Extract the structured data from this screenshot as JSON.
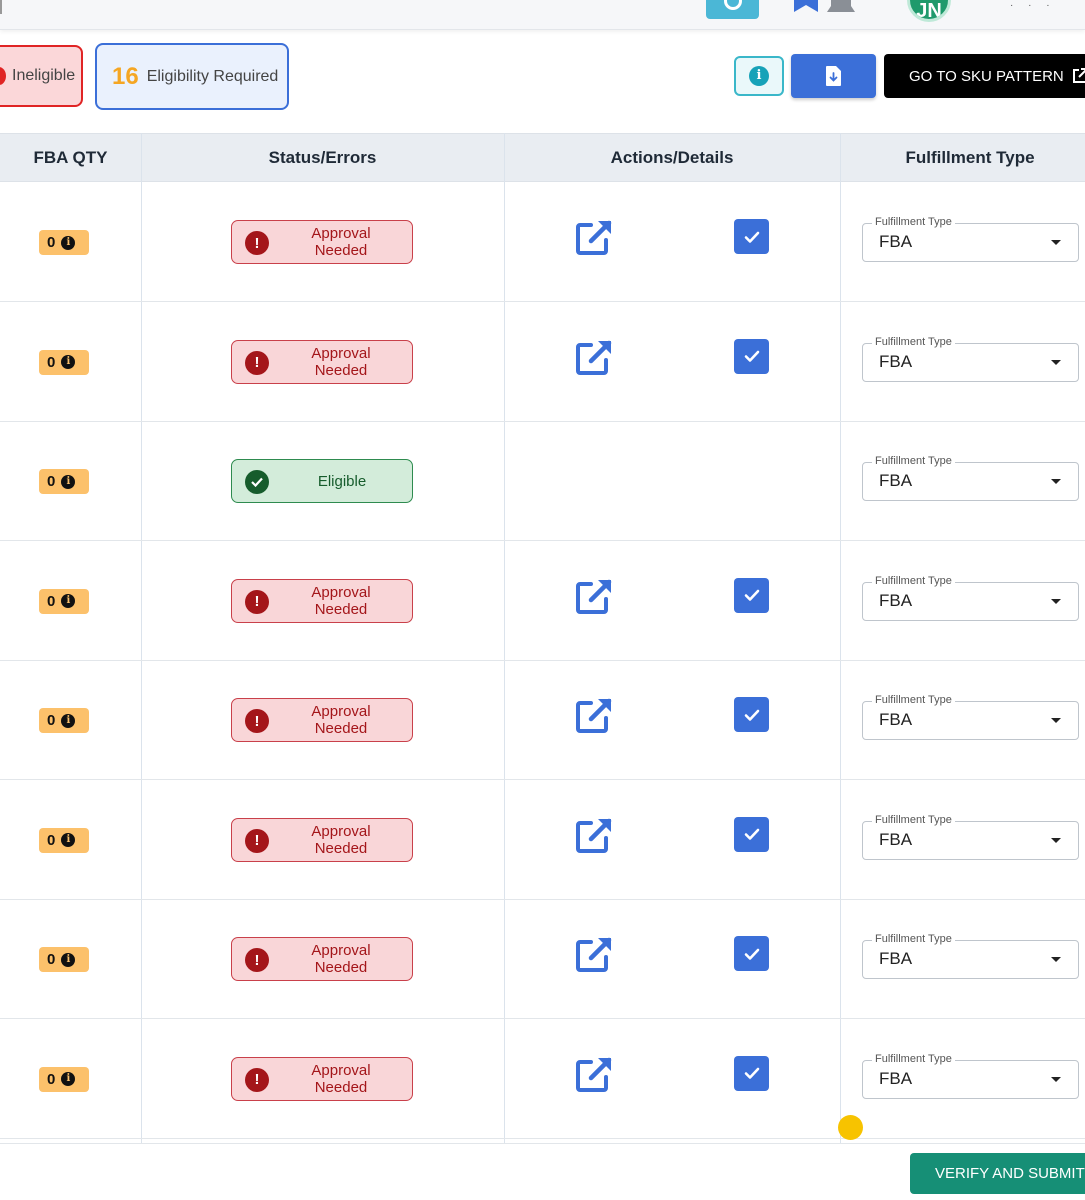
{
  "filters": {
    "ineligible": {
      "label": "Ineligible"
    },
    "eligibility_required": {
      "count": "16",
      "label": "Eligibility Required"
    }
  },
  "toolbar": {
    "info_glyph": "i",
    "sku_pattern_label": "GO TO SKU PATTERN"
  },
  "table": {
    "headers": {
      "qty": "FBA QTY",
      "status": "Status/Errors",
      "actions": "Actions/Details",
      "fulfillment": "Fulfillment Type"
    },
    "rows": [
      {
        "qty": "0",
        "status": "Approval Needed",
        "status_kind": "bad",
        "has_actions": true,
        "fulfillment_legend": "Fulfillment Type",
        "fulfillment_value": "FBA"
      },
      {
        "qty": "0",
        "status": "Approval Needed",
        "status_kind": "bad",
        "has_actions": true,
        "fulfillment_legend": "Fulfillment Type",
        "fulfillment_value": "FBA"
      },
      {
        "qty": "0",
        "status": "Eligible",
        "status_kind": "good",
        "has_actions": false,
        "fulfillment_legend": "Fulfillment Type",
        "fulfillment_value": "FBA"
      },
      {
        "qty": "0",
        "status": "Approval Needed",
        "status_kind": "bad",
        "has_actions": true,
        "fulfillment_legend": "Fulfillment Type",
        "fulfillment_value": "FBA"
      },
      {
        "qty": "0",
        "status": "Approval Needed",
        "status_kind": "bad",
        "has_actions": true,
        "fulfillment_legend": "Fulfillment Type",
        "fulfillment_value": "FBA"
      },
      {
        "qty": "0",
        "status": "Approval Needed",
        "status_kind": "bad",
        "has_actions": true,
        "fulfillment_legend": "Fulfillment Type",
        "fulfillment_value": "FBA"
      },
      {
        "qty": "0",
        "status": "Approval Needed",
        "status_kind": "bad",
        "has_actions": true,
        "fulfillment_legend": "Fulfillment Type",
        "fulfillment_value": "FBA"
      },
      {
        "qty": "0",
        "status": "Approval Needed",
        "status_kind": "bad",
        "has_actions": true,
        "fulfillment_legend": "Fulfillment Type",
        "fulfillment_value": "FBA"
      }
    ]
  },
  "footer": {
    "verify_label": "VERIFY AND SUBMIT"
  },
  "colors": {
    "primary": "#3b6fd8",
    "error": "#a4161a",
    "success": "#165c2c",
    "qty_badge": "#fcc16b",
    "verify": "#168f76"
  },
  "icons": [
    "bookmark-icon",
    "bell-icon",
    "info-icon",
    "download-icon",
    "external-link-icon",
    "open-details-icon",
    "checkbox-checked-icon",
    "alert-circle-icon",
    "check-circle-icon",
    "chevron-down-icon"
  ]
}
